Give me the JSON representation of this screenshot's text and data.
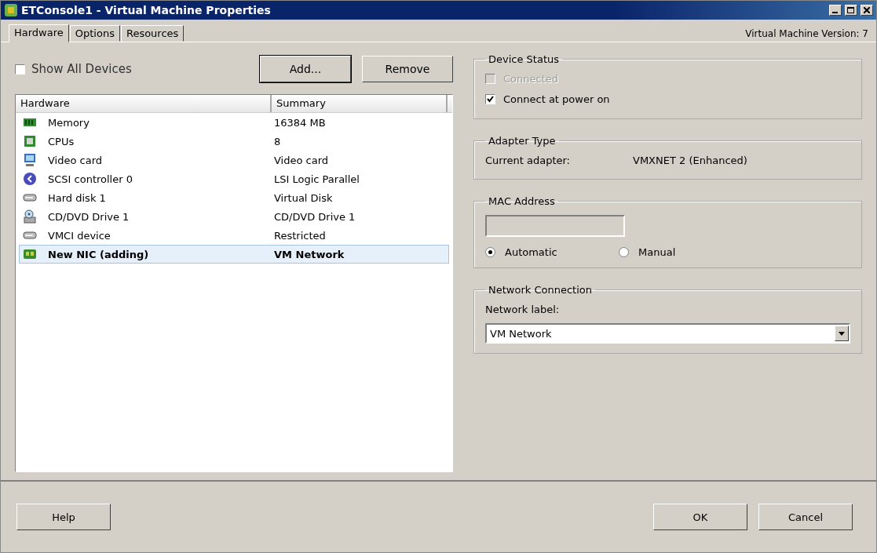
{
  "window": {
    "title": "ETConsole1 - Virtual Machine Properties"
  },
  "tabs": [
    {
      "label": "Hardware",
      "selected": true
    },
    {
      "label": "Options",
      "selected": false
    },
    {
      "label": "Resources",
      "selected": false
    }
  ],
  "version_label": "Virtual Machine Version: 7",
  "show_all_devices": {
    "label": "Show All Devices",
    "checked": false
  },
  "list_buttons": [
    "Add...",
    "Remove"
  ],
  "table": {
    "columns": [
      "Hardware",
      "Summary"
    ],
    "rows": [
      {
        "kind": "memory",
        "name": "Memory",
        "summary": "16384 MB",
        "selected": false
      },
      {
        "kind": "cpu",
        "name": "CPUs",
        "summary": "8",
        "selected": false
      },
      {
        "kind": "video",
        "name": "Video card",
        "summary": "Video card",
        "selected": false
      },
      {
        "kind": "scsi",
        "name": "SCSI controller 0",
        "summary": "LSI Logic Parallel",
        "selected": false
      },
      {
        "kind": "disk",
        "name": "Hard disk 1",
        "summary": "Virtual Disk",
        "selected": false
      },
      {
        "kind": "cdrom",
        "name": "CD/DVD Drive 1",
        "summary": "CD/DVD Drive 1",
        "selected": false
      },
      {
        "kind": "disk",
        "name": "VMCI device",
        "summary": "Restricted",
        "selected": false
      },
      {
        "kind": "nic",
        "name": "New NIC (adding)",
        "summary": "VM Network",
        "selected": true
      }
    ]
  },
  "device_status": {
    "title": "Device Status",
    "options": [
      {
        "label": "Connected",
        "checked": false,
        "disabled": true
      },
      {
        "label": "Connect at power on",
        "checked": true,
        "disabled": false
      }
    ]
  },
  "adapter_type": {
    "title": "Adapter Type",
    "label": "Current adapter:",
    "value": "VMXNET 2 (Enhanced)"
  },
  "mac_address": {
    "title": "MAC Address",
    "options": [
      {
        "label": "Automatic",
        "selected": true
      },
      {
        "label": "Manual",
        "selected": false
      }
    ]
  },
  "network_connection": {
    "title": "Network Connection",
    "label": "Network label:",
    "value": "VM Network"
  },
  "footer_buttons": [
    {
      "label": "Help",
      "kind": "left"
    },
    {
      "label": "OK",
      "kind": "right"
    },
    {
      "label": "Cancel",
      "kind": "right"
    }
  ]
}
